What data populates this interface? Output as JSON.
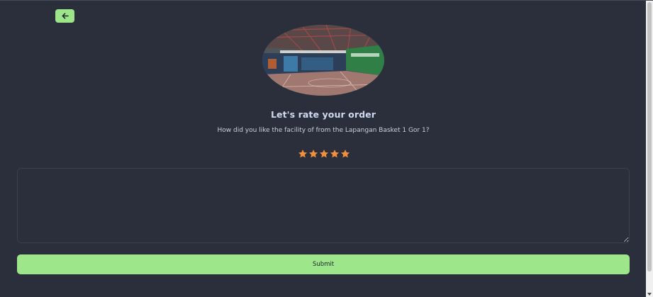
{
  "header": {
    "back_icon": "arrow-left-icon"
  },
  "venue": {
    "image_alt": "indoor basketball court"
  },
  "rating": {
    "title": "Let's rate your order",
    "question": "How did you like the facility of from the Lapangan Basket 1 Gor 1?",
    "stars_value": 5,
    "stars_max": 5,
    "star_icon": "star-icon",
    "star_color": "#f0903c"
  },
  "feedback": {
    "value": "",
    "placeholder": ""
  },
  "actions": {
    "submit_label": "Submit"
  },
  "colors": {
    "background": "#2a2f3b",
    "accent": "#9de68a",
    "title": "#cfdaf0",
    "text": "#c7d0de"
  }
}
